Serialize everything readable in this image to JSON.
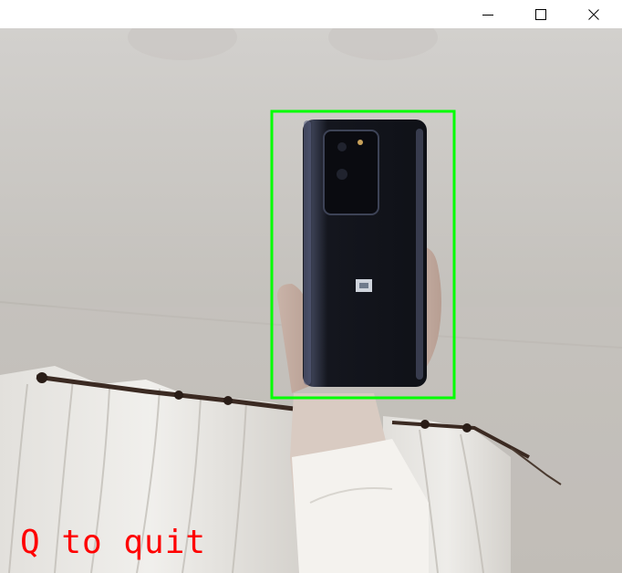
{
  "window": {
    "controls": {
      "minimize_icon": "minimize-icon",
      "maximize_icon": "maximize-icon",
      "close_icon": "close-icon"
    }
  },
  "camera": {
    "overlay_text": "Q to quit",
    "overlay_color": "#ff0000",
    "detection_box_color": "#00ff00",
    "detected_object": "phone"
  }
}
